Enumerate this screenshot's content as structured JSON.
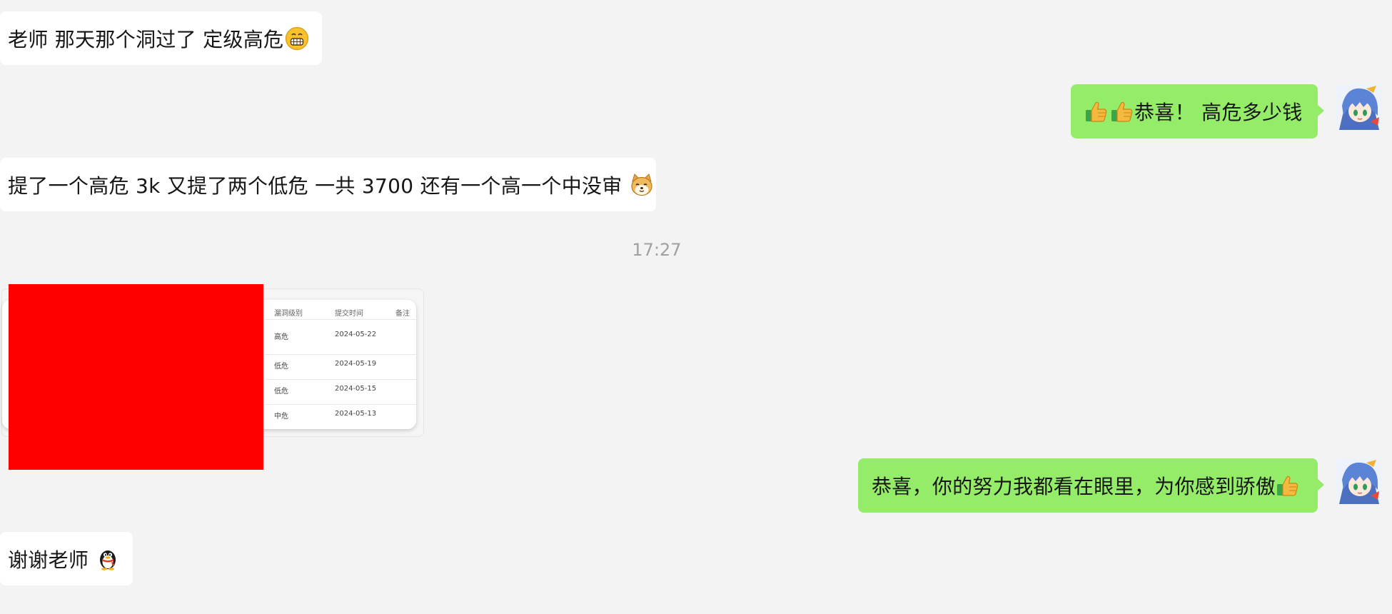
{
  "messages": {
    "m1": {
      "text": "老师 那天那个洞过了 定级高危",
      "trailing_emoji": "grinning-face"
    },
    "m2": {
      "text": "恭喜！ 高危多少钱",
      "leading_emojis": [
        "thumbs-up",
        "thumbs-up"
      ]
    },
    "m3": {
      "text": "提了一个高危 3k 又提了两个低危 一共 3700 还有一个高一个中没审",
      "trailing_emoji": "doge-face"
    },
    "m4": {
      "text": "恭喜，你的努力我都看在眼里，为你感到骄傲",
      "trailing_emoji": "thumbs-up"
    },
    "m5": {
      "text": "谢谢老师",
      "trailing_emoji": "penguin"
    }
  },
  "timestamp": "17:27",
  "screenshot_table": {
    "headers": [
      "漏洞级别",
      "提交时间",
      "备注"
    ],
    "rows": [
      {
        "level": "高危",
        "date": "2024-05-22"
      },
      {
        "level": "低危",
        "date": "2024-05-19"
      },
      {
        "level": "低危",
        "date": "2024-05-15"
      },
      {
        "level": "中危",
        "date": "2024-05-13"
      }
    ]
  },
  "colors": {
    "background": "#f3f3f3",
    "incoming_bubble": "#ffffff",
    "outgoing_bubble": "#95ec69",
    "redaction": "#ff0000"
  }
}
